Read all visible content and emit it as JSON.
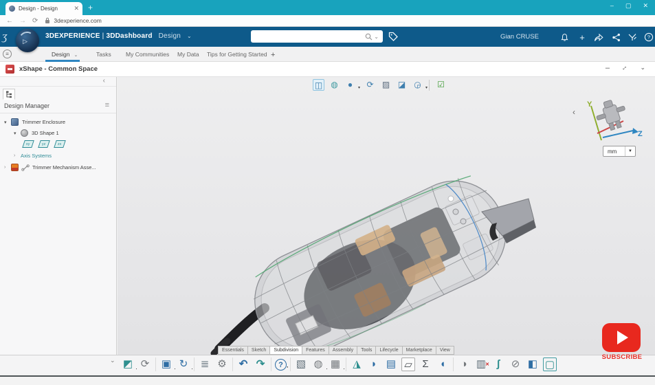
{
  "browser": {
    "tab_title": "Design - Design",
    "close_tab": "✕",
    "new_tab": "+",
    "back": "←",
    "forward": "→",
    "reload": "⟳",
    "url": "3dexperience.com",
    "minimize": "–",
    "maximize": "▢",
    "close": "✕"
  },
  "header": {
    "logo_glyph": "ʒ",
    "brand": "3DEXPERIENCE",
    "divider": "|",
    "app": "3DDashboard",
    "context": "Design",
    "context_caret": "⌄",
    "search_value": "",
    "search_caret": "⌄",
    "user": "Gian CRUSE",
    "icon_names": [
      "notification-bell-icon",
      "add-icon",
      "share-arrow-icon",
      "share-network-icon",
      "3dplay-icon",
      "help-icon"
    ],
    "add_glyph": "+"
  },
  "dashboard_tabs": {
    "menu_glyph": "≡",
    "items": [
      {
        "label": "Design",
        "caret": "⌄",
        "active": true
      },
      {
        "label": "Tasks"
      },
      {
        "label": "My Communities"
      },
      {
        "label": "My Data"
      },
      {
        "label": "Tips for Getting Started"
      }
    ],
    "add": "+"
  },
  "app_bar": {
    "title": "xShape - Common Space",
    "minimize": "–",
    "caret": "⌄"
  },
  "design_manager": {
    "collapse": "‹",
    "title": "Design Manager",
    "menu_glyph": "≡",
    "tree": {
      "root": {
        "expander": "▾",
        "label": "Trimmer Enclosure"
      },
      "shape": {
        "expander": "▾",
        "label": "3D Shape 1"
      },
      "planes": [
        {
          "label": "xy"
        },
        {
          "label": "yz"
        },
        {
          "label": "zx"
        }
      ],
      "axis": {
        "expander": "›",
        "label": "Axis Systems"
      },
      "mechanism": {
        "expander": "›",
        "label": "Trimmer Mechanism Asse..."
      }
    }
  },
  "viewport": {
    "top_toolbar_icons": [
      {
        "name": "view-split-icon",
        "glyph": "◫"
      },
      {
        "name": "shaded-view-icon",
        "glyph": "◍"
      },
      {
        "name": "render-style-icon",
        "glyph": "●",
        "caret": "▾"
      },
      {
        "name": "rotate-view-icon",
        "glyph": "⟳"
      },
      {
        "name": "material-view-icon",
        "glyph": "▨"
      },
      {
        "name": "section-view-icon",
        "glyph": "◪"
      },
      {
        "name": "view-cube-icon",
        "glyph": "◶",
        "caret": "▾"
      },
      {
        "name": "update-status-icon",
        "glyph": "☑"
      }
    ],
    "collapse": "‹",
    "axis": {
      "y": "Y",
      "z": "Z"
    },
    "unit": {
      "value": "mm",
      "caret": "▼"
    }
  },
  "action_bar": {
    "tabs": [
      {
        "label": "Essentials"
      },
      {
        "label": "Sketch"
      },
      {
        "label": "Subdivision",
        "active": true
      },
      {
        "label": "Features"
      },
      {
        "label": "Assembly"
      },
      {
        "label": "Tools"
      },
      {
        "label": "Lifecycle"
      },
      {
        "label": "Marketplace"
      },
      {
        "label": "View"
      }
    ]
  },
  "bottom_toolbar": {
    "collapse": "⌄",
    "icons": [
      {
        "name": "new-content-icon",
        "glyph": "◩",
        "mark": "·"
      },
      {
        "name": "open-content-icon",
        "glyph": "⟳"
      },
      {
        "name": "save-icon",
        "glyph": "▣",
        "mark": "·"
      },
      {
        "name": "update-icon",
        "glyph": "↻",
        "mark": "·"
      },
      {
        "name": "properties-icon",
        "glyph": "≣"
      },
      {
        "name": "settings-gear-icon",
        "glyph": "⚙"
      },
      {
        "name": "undo-icon",
        "glyph": "↶"
      },
      {
        "name": "redo-icon",
        "glyph": "↷"
      },
      {
        "name": "help-icon",
        "glyph": "?",
        "mark": "·"
      },
      {
        "name": "subdivision-box-icon",
        "glyph": "▧"
      },
      {
        "name": "sphere-cage-icon",
        "glyph": "◍",
        "mark": "·"
      },
      {
        "name": "grid-plane-icon",
        "glyph": "▦",
        "mark": "·"
      },
      {
        "name": "pyramid-primitive-icon",
        "glyph": "◮"
      },
      {
        "name": "curved-surface-icon",
        "glyph": "◗"
      },
      {
        "name": "patch-grid-icon",
        "glyph": "▤"
      },
      {
        "name": "polygon-face-icon",
        "glyph": "▱"
      },
      {
        "name": "extrude-icon",
        "glyph": "Σ"
      },
      {
        "name": "bend-surface-icon",
        "glyph": "◖"
      },
      {
        "name": "sphere-tool-icon",
        "glyph": "◑"
      },
      {
        "name": "delete-face-icon",
        "glyph": "▥",
        "mark_red": "✕"
      },
      {
        "name": "blade-cut-icon",
        "glyph": "ʃ"
      },
      {
        "name": "trim-sphere-icon",
        "glyph": "⊘"
      },
      {
        "name": "split-face-icon",
        "glyph": "◧"
      },
      {
        "name": "cage-frame-icon",
        "glyph": "▢"
      }
    ]
  },
  "overlay": {
    "subscribe": "SUBSCRIBE"
  },
  "colors": {
    "titlebar": "#18a3bd",
    "header_blue": "#0e5a8a",
    "accent_blue": "#2e86c1",
    "tree_teal": "#2e8b96",
    "update_green": "#3f9c35",
    "youtube_red": "#e8281e"
  }
}
